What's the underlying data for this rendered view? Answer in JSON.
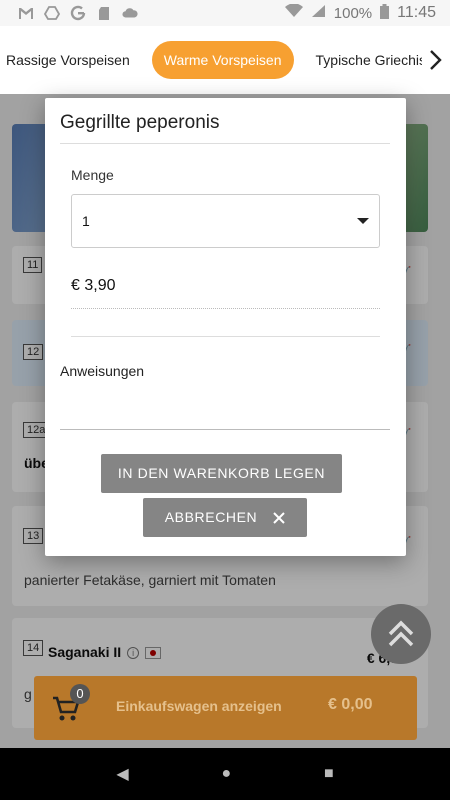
{
  "status_bar": {
    "battery": "100%",
    "time": "11:45",
    "left_icons": [
      "gmail-icon",
      "drive-icon",
      "google-icon",
      "sd-card-icon",
      "cloud-icon"
    ],
    "right_icons": [
      "wifi-icon",
      "signal-icon",
      "battery-icon"
    ]
  },
  "tabs": {
    "items": [
      {
        "label": "Rassige Vorspeisen",
        "active": false
      },
      {
        "label": "Warme Vorspeisen",
        "active": true
      },
      {
        "label": "Typische Griechische"
      }
    ],
    "accent": "#f7a031"
  },
  "background_items": [
    {
      "num": "11"
    },
    {
      "num": "12"
    },
    {
      "num": "12a",
      "name_partial": "übe"
    },
    {
      "num": "13",
      "description": "panierter Fetakäse, garniert mit Tomaten"
    },
    {
      "num": "14",
      "name": "Saganaki II",
      "price_partial": "€ 6,9",
      "desc_partial": "g"
    }
  ],
  "dialog": {
    "title": "Gegrillte peperonis",
    "quantity_label": "Menge",
    "quantity_value": "1",
    "price": "€ 3,90",
    "instructions_label": "Anweisungen",
    "instructions_value": "",
    "add_button": "IN DEN WARENKORB LEGEN",
    "cancel_button": "ABBRECHEN"
  },
  "cart": {
    "count": "0",
    "label": "Einkaufswagen anzeigen",
    "total": "€ 0,00"
  },
  "nav": {
    "back": "◀",
    "home": "●",
    "recents": "■"
  }
}
